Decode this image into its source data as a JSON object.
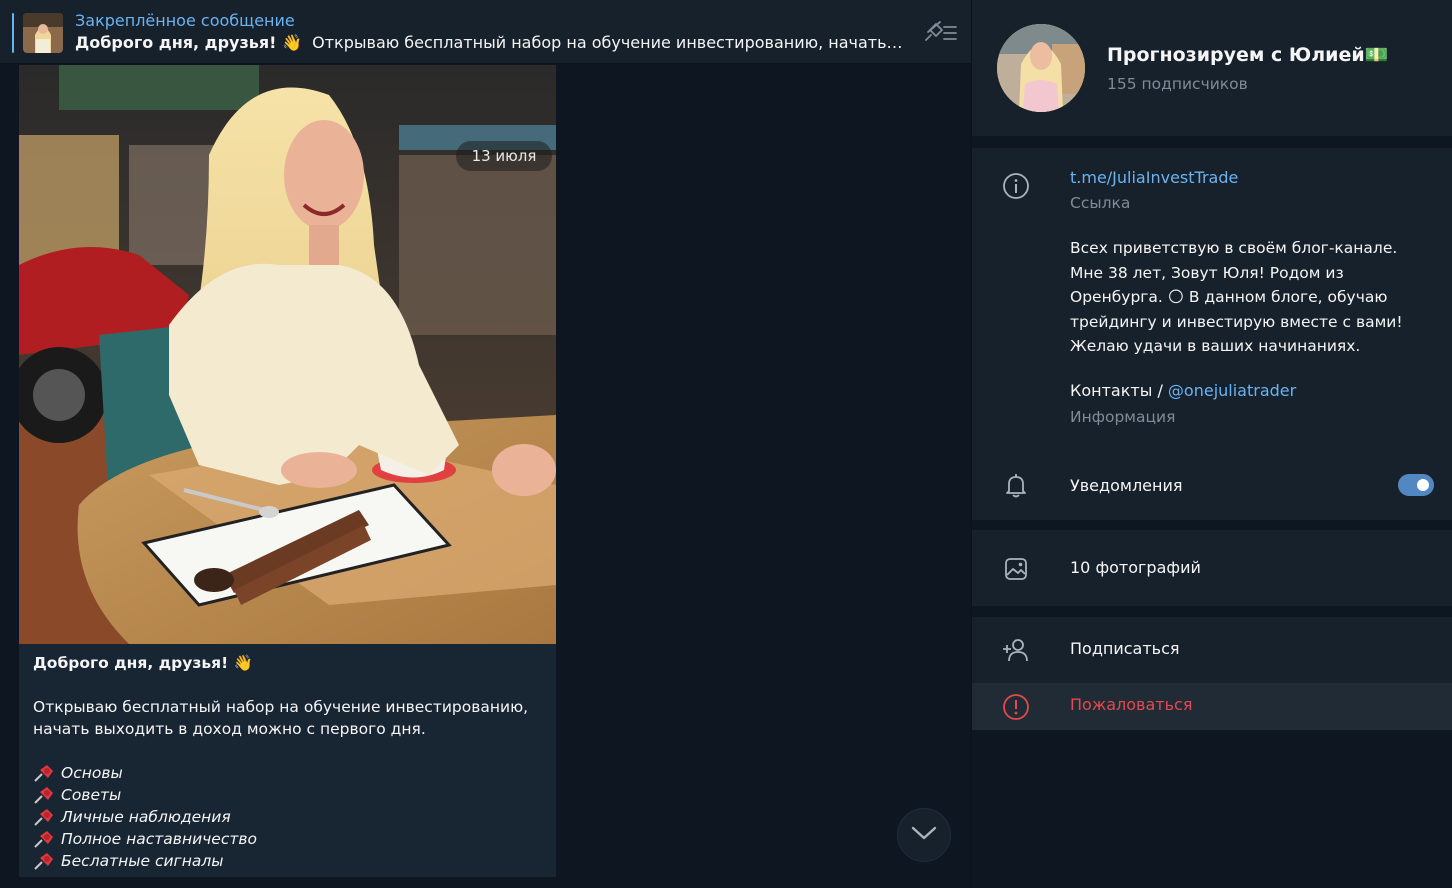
{
  "pinned": {
    "title": "Закреплённое сообщение",
    "text_bold": "Доброго дня, друзья! 👋",
    "text_rest": "Открываю бесплатный набор на обучение инвестированию, начать выходит..."
  },
  "message": {
    "date": "13 июля",
    "caption_title": "Доброго дня, друзья! 👋",
    "caption_body": "Открываю бесплатный набор на обучение инвестированию, начать выходить в доход можно с первого дня.",
    "items": [
      "Основы",
      "Советы",
      "Личные наблюдения",
      "Полное наставничество",
      "Беслатные сигналы"
    ]
  },
  "channel": {
    "name": "Прогнозируем с Юлией💵",
    "subscribers": "155 подписчиков",
    "link": "t.me/JuliaInvestTrade",
    "link_label": "Ссылка",
    "description": "Всех приветствую в своём блог-канале. Мне 38 лет, Зовут Юля! Родом из Оренбурга. 🌕 В данном блоге, обучаю трейдингу и инвестирую вместе с вами! Желаю удачи в ваших начинаниях.",
    "contacts_prefix": "Контакты / ",
    "contacts_handle": "@onejuliatrader",
    "contacts_label": "Информация",
    "notifications_label": "Уведомления",
    "notifications_on": true,
    "photos_label": "10 фотографий",
    "subscribe_label": "Подписаться",
    "report_label": "Пожаловаться"
  },
  "icons": {
    "unpin": "unpin-icon",
    "info": "info-icon",
    "bell": "bell-icon",
    "photo": "photo-icon",
    "add_user": "add-user-icon",
    "report": "report-icon",
    "scroll_down": "chevron-down-icon"
  },
  "colors": {
    "accent_link": "#6ab3f3",
    "toggle": "#5288c1",
    "danger": "#e5494d",
    "panel_bg": "#17212b",
    "chat_bg": "#0e1621"
  }
}
